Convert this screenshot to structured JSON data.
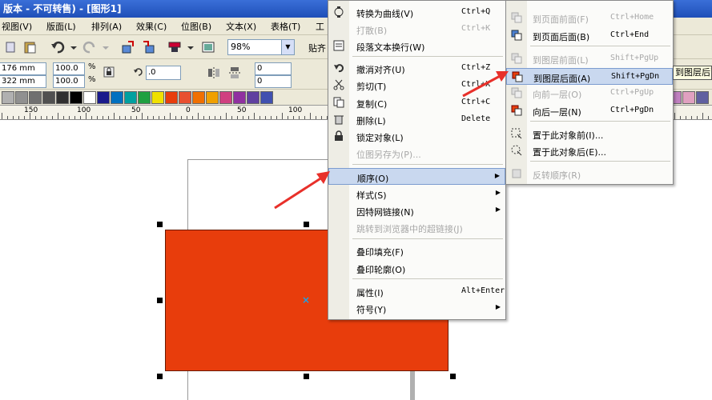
{
  "window": {
    "title": "版本 - 不可转售) - [图形1]"
  },
  "menubar": {
    "items": [
      "视图(V)",
      "版面(L)",
      "排列(A)",
      "效果(C)",
      "位图(B)",
      "文本(X)",
      "表格(T)",
      "工"
    ]
  },
  "toolbar": {
    "zoom": "98%",
    "paste_label": "贴齐"
  },
  "property_bar": {
    "width": "176 mm",
    "height": "322 mm",
    "scale_x": "100.0",
    "scale_y": "100.0",
    "percent": "%",
    "rotation": ".0",
    "offset_a": "0",
    "offset_b": "0"
  },
  "palette": {
    "colors": [
      "#b0b0b0",
      "#909090",
      "#707070",
      "#505050",
      "#303030",
      "#000000",
      "#ffffff",
      "#1a1a8c",
      "#0070c0",
      "#00a0a0",
      "#20a040",
      "#f0e000",
      "#e83d0c",
      "#e85030",
      "#f07000",
      "#f0a000",
      "#d04080",
      "#9030a0",
      "#6040a0",
      "#4050b0"
    ],
    "right_colors": [
      "#c0c030",
      "#e0e040",
      "#8080c0",
      "#c080c0",
      "#e0a0c0",
      "#6060a0"
    ]
  },
  "ruler": {
    "labels": [
      "150",
      "100",
      "50",
      "0",
      "50",
      "100"
    ]
  },
  "context_menu": {
    "items": [
      {
        "label": "转换为曲线(V)",
        "shortcut": "Ctrl+Q",
        "disabled": false,
        "icon": "curve-icon"
      },
      {
        "label": "打散(B)",
        "shortcut": "Ctrl+K",
        "disabled": true,
        "icon": ""
      },
      {
        "label": "段落文本换行(W)",
        "shortcut": "",
        "disabled": false,
        "icon": "wrap-icon"
      },
      {
        "label": "撤消对齐(U)",
        "shortcut": "Ctrl+Z",
        "disabled": false,
        "icon": "undo-icon"
      },
      {
        "label": "剪切(T)",
        "shortcut": "Ctrl+X",
        "disabled": false,
        "icon": "scissors-icon"
      },
      {
        "label": "复制(C)",
        "shortcut": "Ctrl+C",
        "disabled": false,
        "icon": "copy-icon"
      },
      {
        "label": "删除(L)",
        "shortcut": "Delete",
        "disabled": false,
        "icon": "trash-icon"
      },
      {
        "label": "锁定对象(L)",
        "shortcut": "",
        "disabled": false,
        "icon": "lock-icon"
      },
      {
        "label": "位图另存为(P)...",
        "shortcut": "",
        "disabled": true,
        "icon": ""
      },
      {
        "label": "顺序(O)",
        "shortcut": "",
        "disabled": false,
        "submenu": true,
        "highlighted": true
      },
      {
        "label": "样式(S)",
        "shortcut": "",
        "disabled": false,
        "submenu": true
      },
      {
        "label": "因特网链接(N)",
        "shortcut": "",
        "disabled": false,
        "submenu": true
      },
      {
        "label": "跳转到浏览器中的超链接(J)",
        "shortcut": "",
        "disabled": true
      },
      {
        "label": "叠印填充(F)",
        "shortcut": "",
        "disabled": false
      },
      {
        "label": "叠印轮廓(O)",
        "shortcut": "",
        "disabled": false
      },
      {
        "label": "属性(I)",
        "shortcut": "Alt+Enter",
        "disabled": false
      },
      {
        "label": "符号(Y)",
        "shortcut": "",
        "disabled": false,
        "submenu": true
      }
    ]
  },
  "order_submenu": {
    "items": [
      {
        "label": "到页面前面(F)",
        "shortcut": "Ctrl+Home",
        "disabled": true,
        "icon": "to-page-front-icon"
      },
      {
        "label": "到页面后面(B)",
        "shortcut": "Ctrl+End",
        "disabled": false,
        "icon": "to-page-back-icon"
      },
      {
        "label": "到图层前面(L)",
        "shortcut": "Shift+PgUp",
        "disabled": true,
        "icon": "to-layer-front-icon"
      },
      {
        "label": "到图层后面(A)",
        "shortcut": "Shift+PgDn",
        "disabled": false,
        "highlighted": true,
        "icon": "to-layer-back-icon"
      },
      {
        "label": "向前一层(O)",
        "shortcut": "Ctrl+PgUp",
        "disabled": true,
        "icon": "forward-one-icon"
      },
      {
        "label": "向后一层(N)",
        "shortcut": "Ctrl+PgDn",
        "disabled": false,
        "icon": "back-one-icon"
      },
      {
        "label": "置于此对象前(I)...",
        "shortcut": "",
        "disabled": false,
        "icon": "in-front-of-icon"
      },
      {
        "label": "置于此对象后(E)...",
        "shortcut": "",
        "disabled": false,
        "icon": "behind-icon"
      },
      {
        "label": "反转顺序(R)",
        "shortcut": "",
        "disabled": true,
        "icon": "reverse-order-icon"
      }
    ]
  },
  "tooltip": {
    "text": "到图层后面"
  },
  "colors": {
    "shape_fill": "#e83d0c",
    "highlight": "#c9d8ef",
    "arrow": "#e8302a"
  }
}
